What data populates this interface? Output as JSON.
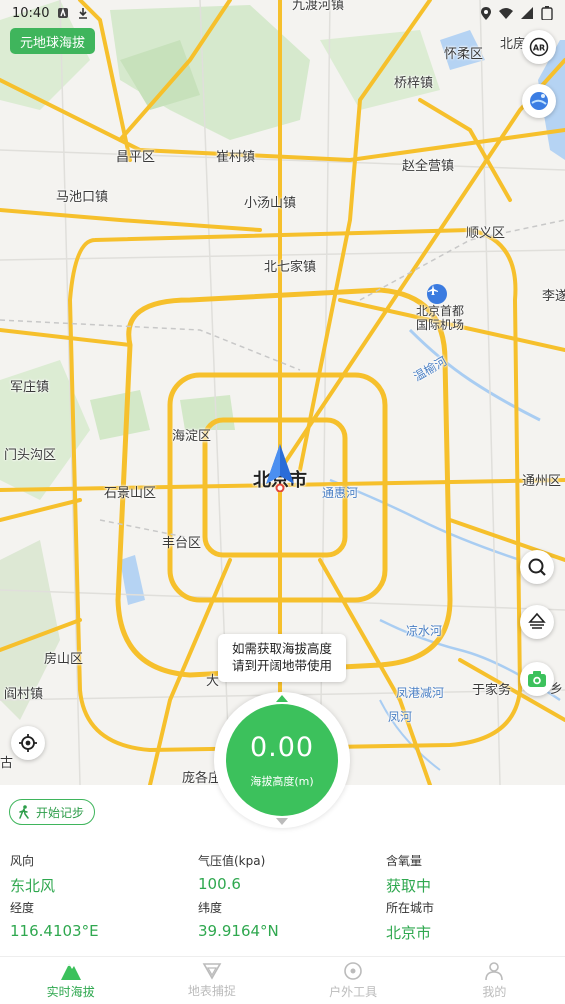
{
  "status_bar": {
    "time": "10:40"
  },
  "badge": {
    "label": "元地球海拔"
  },
  "map": {
    "places": [
      {
        "id": "jiudu",
        "text": "九渡河镇"
      },
      {
        "id": "huairou",
        "text": "怀柔区"
      },
      {
        "id": "beifang",
        "text": "北房"
      },
      {
        "id": "qiaozi",
        "text": "桥梓镇"
      },
      {
        "id": "changping",
        "text": "昌平区"
      },
      {
        "id": "cuicun",
        "text": "崔村镇"
      },
      {
        "id": "zhaoquanying",
        "text": "赵全营镇"
      },
      {
        "id": "machikou",
        "text": "马池口镇"
      },
      {
        "id": "xiaotangshan",
        "text": "小汤山镇"
      },
      {
        "id": "shunyi",
        "text": "顺义区"
      },
      {
        "id": "beiqijia",
        "text": "北七家镇"
      },
      {
        "id": "liqiao",
        "text": "李遂"
      },
      {
        "id": "airport",
        "text": "北京首都\n国际机场"
      },
      {
        "id": "wenyu",
        "text": "温榆河"
      },
      {
        "id": "junzhuang",
        "text": "军庄镇"
      },
      {
        "id": "haidian",
        "text": "海淀区"
      },
      {
        "id": "mentougou",
        "text": "门头沟区"
      },
      {
        "id": "shijingshan",
        "text": "石景山区"
      },
      {
        "id": "beijing",
        "text": "北京市"
      },
      {
        "id": "tonghui",
        "text": "通惠河"
      },
      {
        "id": "tongzhou",
        "text": "通州区"
      },
      {
        "id": "fengtai",
        "text": "丰台区"
      },
      {
        "id": "liangshui",
        "text": "凉水河"
      },
      {
        "id": "fangshan",
        "text": "房山区"
      },
      {
        "id": "yanchun",
        "text": "阎村镇"
      },
      {
        "id": "fenggang",
        "text": "凤港减河"
      },
      {
        "id": "yujiawu",
        "text": "于家务"
      },
      {
        "id": "fenghe",
        "text": "凤河"
      },
      {
        "id": "daxing",
        "text": "大"
      },
      {
        "id": "pangge",
        "text": "庞各庄"
      },
      {
        "id": "xiang",
        "text": "乡"
      },
      {
        "id": "gu",
        "text": "古"
      }
    ]
  },
  "tooltip": {
    "line1": "如需获取海拔高度",
    "line2": "请到开阔地带使用"
  },
  "altitude": {
    "value": "0.00",
    "label": "海拔高度(m)"
  },
  "panel": {
    "step_button": "开始记步",
    "stats": [
      {
        "label": "风向",
        "value": "东北风"
      },
      {
        "label": "气压值(kpa)",
        "value": "100.6"
      },
      {
        "label": "含氧量",
        "value": "获取中"
      },
      {
        "label": "经度",
        "value": "116.4103°E"
      },
      {
        "label": "纬度",
        "value": "39.9164°N"
      },
      {
        "label": "所在城市",
        "value": "北京市"
      }
    ]
  },
  "nav": [
    {
      "label": "实时海拔",
      "icon": "mountain-icon",
      "active": true
    },
    {
      "label": "地表捕捉",
      "icon": "triangle-ruler-icon",
      "active": false
    },
    {
      "label": "户外工具",
      "icon": "compass-icon",
      "active": false
    },
    {
      "label": "我的",
      "icon": "person-icon",
      "active": false
    }
  ],
  "colors": {
    "accent": "#3cc15c",
    "road": "#f6c02c",
    "water": "#a9cdf2",
    "park": "#cfe6c4"
  },
  "icons": [
    "ar-icon",
    "globe-icon",
    "search-icon",
    "layers-icon",
    "camera-icon",
    "locate-icon",
    "walk-icon",
    "airport-icon",
    "navigation-arrow-icon"
  ]
}
